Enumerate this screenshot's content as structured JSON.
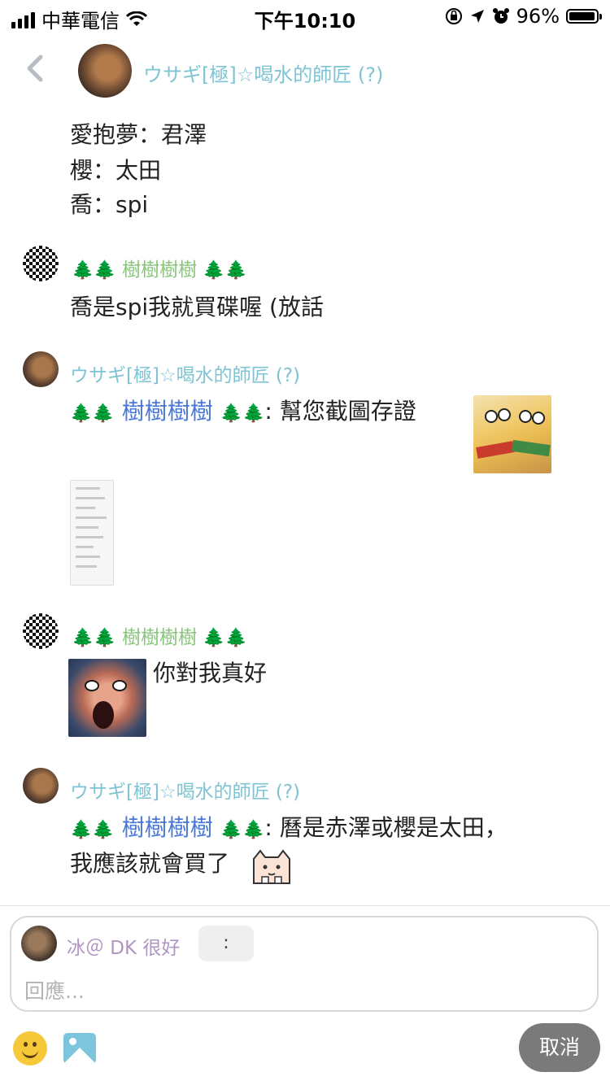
{
  "status_bar": {
    "carrier": "中華電信",
    "time": "下午10:10",
    "battery": "96%",
    "battery_level": 0.96
  },
  "header": {
    "title": "ウサギ[極]☆喝水的師匠 (?)",
    "back_icon": "chevron-left-icon"
  },
  "top_lines": [
    "愛抱夢：君澤",
    "櫻：太田",
    "喬：spi"
  ],
  "messages": [
    {
      "sender": "樹樹樹樹",
      "sender_tree": "🌲🌲",
      "text": "喬是spi我就買碟喔 (放話"
    },
    {
      "sender": "ウサギ[極]☆喝水的師匠 (?)",
      "mention": "樹樹樹樹",
      "mention_tree": "🌲🌲",
      "text": ": 幫您截圖存證"
    },
    {
      "sender": "樹樹樹樹",
      "sender_tree": "🌲🌲",
      "text": "你對我真好"
    },
    {
      "sender": "ウサギ[極]☆喝水的師匠 (?)",
      "mention": "樹樹樹樹",
      "mention_tree": "🌲🌲",
      "text_line1": ": 曆是赤澤或櫻是太田，",
      "text_line2": "我應該就會買了"
    }
  ],
  "reply": {
    "user": "冰＠ DK 很好",
    "chip": ":",
    "placeholder": "回應..."
  },
  "actions": {
    "cancel": "取消"
  }
}
